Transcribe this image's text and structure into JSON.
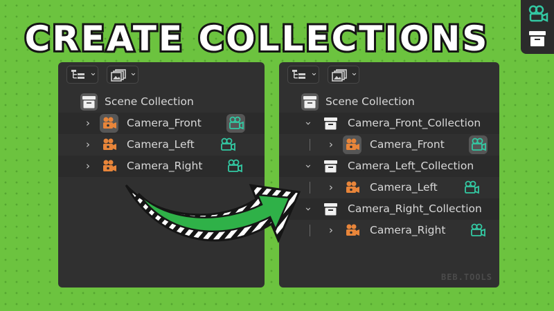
{
  "banner": {
    "title": "CREATE COLLECTIONS"
  },
  "left_panel": {
    "scene_collection": "Scene Collection",
    "objects": [
      "Camera_Front",
      "Camera_Left",
      "Camera_Right"
    ]
  },
  "right_panel": {
    "scene_collection": "Scene Collection",
    "collections": [
      {
        "name": "Camera_Front_Collection",
        "object": "Camera_Front"
      },
      {
        "name": "Camera_Left_Collection",
        "object": "Camera_Left"
      },
      {
        "name": "Camera_Right_Collection",
        "object": "Camera_Right"
      }
    ],
    "watermark": "BEB.TOOLS"
  },
  "icons": {
    "camera_object": "camera-object-icon",
    "camera_data": "camera-data-icon",
    "collection": "collection-box-icon",
    "disclosure": "chevron-right-icon",
    "arrow": "curved-arrow-icon"
  },
  "colors": {
    "background": "#6cc33f",
    "panel": "#303030",
    "camera_object": "#e8853a",
    "camera_data": "#33c9a3",
    "arrow_green": "#2fb148"
  }
}
